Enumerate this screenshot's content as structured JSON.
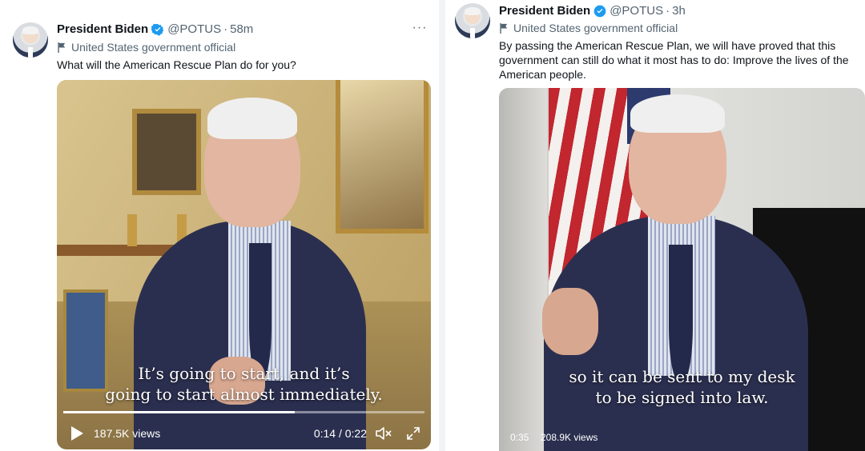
{
  "tweets": [
    {
      "display_name": "President Biden",
      "handle": "@POTUS",
      "separator": "·",
      "time": "58m",
      "label": "United States government official",
      "text": "What will the American Rescue Plan do for you?",
      "more": "···",
      "video": {
        "caption_line1": "It’s going to start, and it’s",
        "caption_line2": "going to start almost immediately.",
        "views": "187.5K views",
        "time_display": "0:14 / 0:22",
        "progress_fraction": 0.64
      }
    },
    {
      "display_name": "President Biden",
      "handle": "@POTUS",
      "separator": "·",
      "time": "3h",
      "label": "United States government official",
      "text": "By passing the American Rescue Plan, we will have proved that this government can still do what it most has to do: Improve the lives of the American people.",
      "video": {
        "caption_line1": "so it can be sent to my desk",
        "caption_line2": "to be signed into law.",
        "time_remaining": "0:35",
        "views": "208.9K views"
      }
    }
  ],
  "colors": {
    "verified_blue": "#1d9bf0",
    "secondary_text": "#536471",
    "primary_text": "#0f1419"
  },
  "icons": [
    "verified-badge-icon",
    "flag-icon",
    "more-icon",
    "play-icon",
    "volume-icon",
    "fullscreen-icon"
  ]
}
